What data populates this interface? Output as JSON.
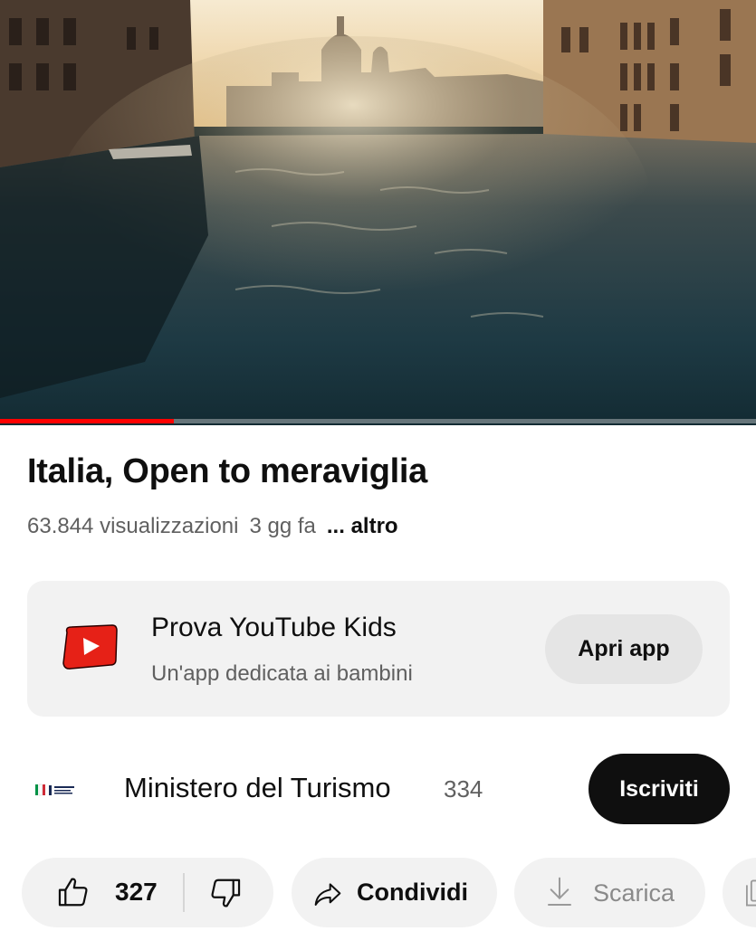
{
  "video": {
    "title": "Italia, Open to meraviglia",
    "views": "63.844 visualizzazioni",
    "age": "3 gg fa",
    "more_label": "... altro",
    "progress_fraction": 0.23
  },
  "promo": {
    "title": "Prova YouTube Kids",
    "subtitle": "Un'app dedicata ai bambini",
    "button_label": "Apri app",
    "icon": "youtube-kids-icon"
  },
  "channel": {
    "name": "Ministero del Turismo",
    "subscribers": "334",
    "subscribe_label": "Iscriviti"
  },
  "actions": {
    "like_count": "327",
    "share_label": "Condividi",
    "download_label": "Scarica"
  },
  "colors": {
    "accent": "#ff0000",
    "subscribe_bg": "#0f0f0f",
    "pill_bg": "#f2f2f2",
    "secondary_text": "#606060"
  }
}
